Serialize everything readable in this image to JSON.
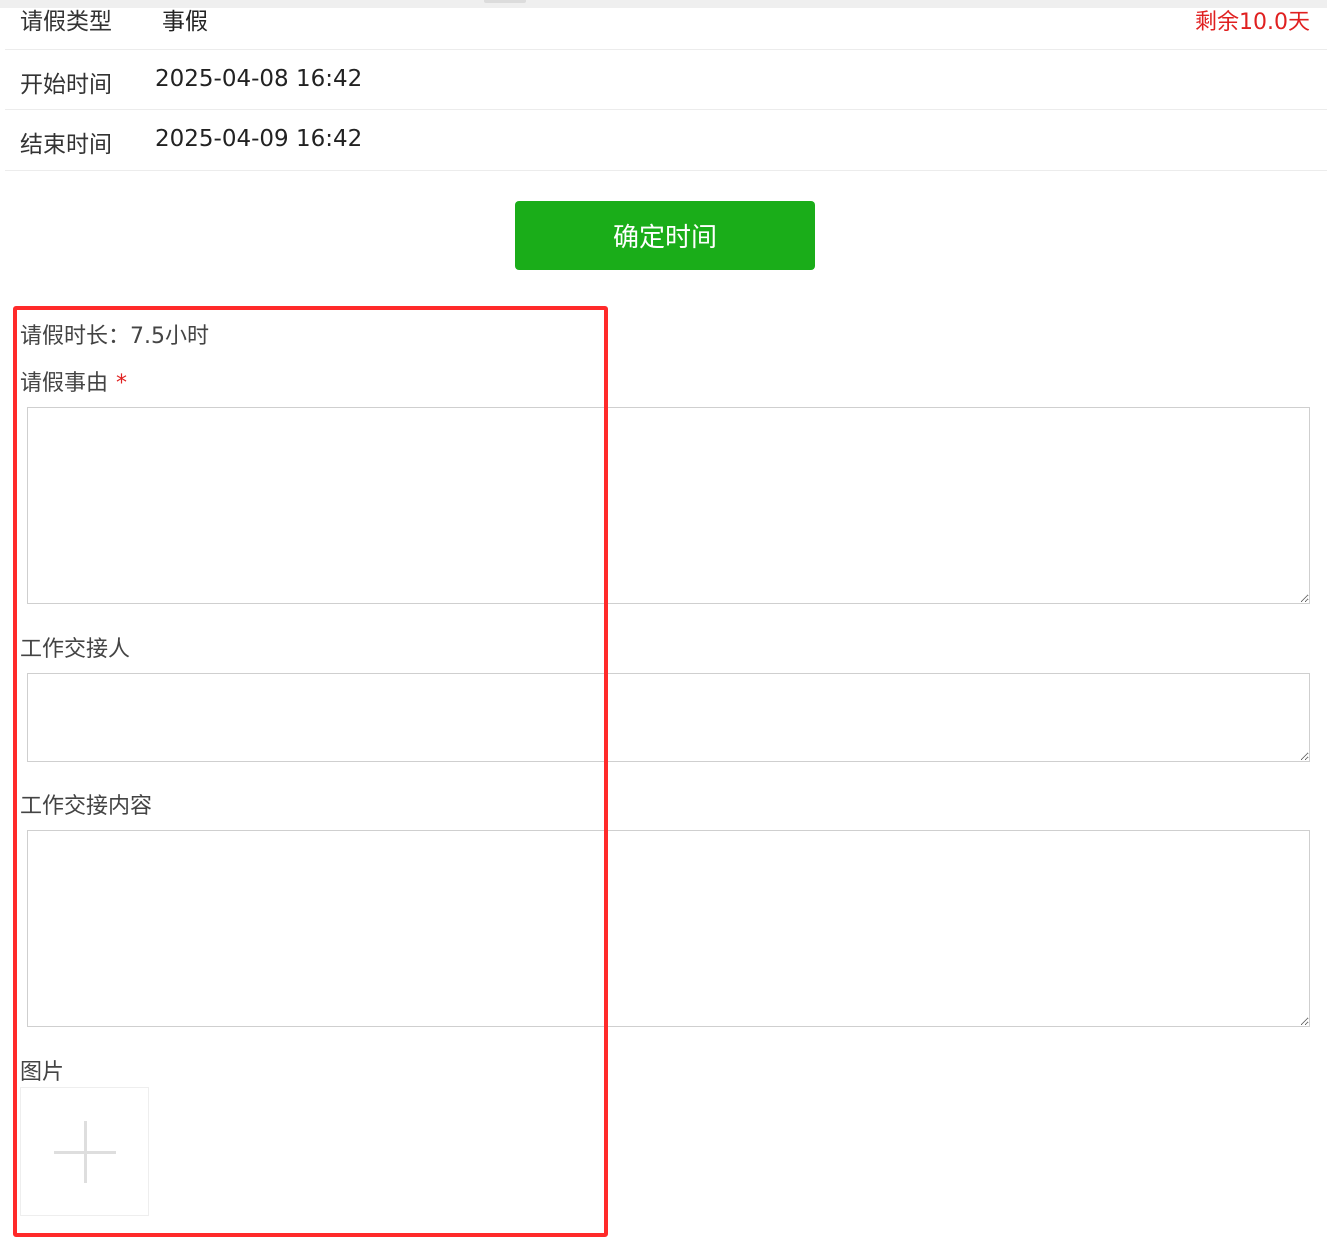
{
  "header_rows": {
    "leave_type": {
      "label": "请假类型",
      "value": "事假",
      "remaining": "剩余10.0天"
    },
    "start_time": {
      "label": "开始时间",
      "value": "2025-04-08 16:42"
    },
    "end_time": {
      "label": "结束时间",
      "value": "2025-04-09 16:42"
    }
  },
  "confirm_button": {
    "label": "确定时间"
  },
  "form": {
    "duration_text": "请假时长：7.5小时",
    "reason": {
      "label": "请假事由",
      "required_mark": "*",
      "value": ""
    },
    "handover_person": {
      "label": "工作交接人",
      "value": ""
    },
    "handover_content": {
      "label": "工作交接内容",
      "value": ""
    },
    "images": {
      "label": "图片",
      "upload_icon": "plus-icon"
    }
  },
  "colors": {
    "accent_green": "#1aad19",
    "alert_red": "#e02020",
    "highlight_red": "#ff2a2a"
  }
}
